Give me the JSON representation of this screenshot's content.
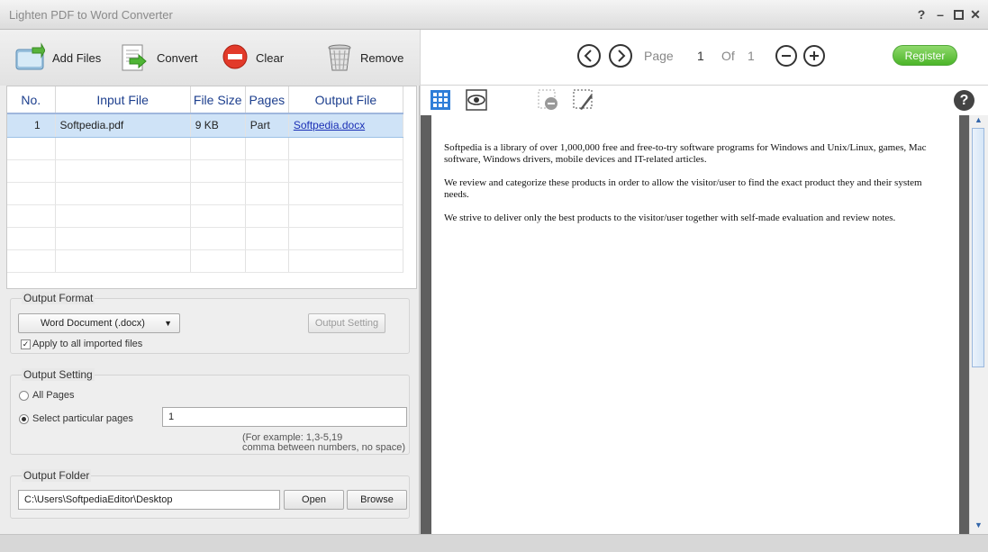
{
  "window": {
    "title": "Lighten PDF to Word Converter"
  },
  "toolbar": {
    "add_files": "Add Files",
    "convert": "Convert",
    "clear": "Clear",
    "remove": "Remove"
  },
  "table": {
    "columns": [
      "No.",
      "Input File",
      "File Size",
      "Pages",
      "Output File"
    ],
    "rows": [
      {
        "no": "1",
        "input": "Softpedia.pdf",
        "size": "9 KB",
        "pages": "Part",
        "output": "Softpedia.docx"
      }
    ]
  },
  "output_format": {
    "title": "Output Format",
    "selected": "Word Document (.docx)",
    "output_setting_btn": "Output Setting",
    "apply_all_label": "Apply to all imported files",
    "apply_all_checked": true
  },
  "output_setting": {
    "title": "Output Setting",
    "all_pages": "All Pages",
    "select_pages": "Select particular pages",
    "pages_value": "1",
    "hint_line1": "(For example: 1,3-5,19",
    "hint_line2": "comma between numbers, no space)"
  },
  "output_folder": {
    "title": "Output Folder",
    "path": "C:\\Users\\SoftpediaEditor\\Desktop",
    "open": "Open",
    "browse": "Browse"
  },
  "viewer": {
    "page_label": "Page",
    "current_page": "1",
    "of_label": "Of",
    "total_pages": "1",
    "register": "Register",
    "paragraphs": [
      "Softpedia is a library of over 1,000,000 free and free-to-try software programs for Windows and Unix/Linux, games, Mac software, Windows drivers, mobile devices and IT-related articles.",
      "We review and categorize these products in order to allow the visitor/user to find the exact product they and their system needs.",
      "We strive to deliver only the best products to the visitor/user together with self-made evaluation and review notes."
    ]
  },
  "colors": {
    "accent": "#4bb528",
    "link": "#1a2fb5",
    "selected_row": "#cfe3f7"
  }
}
